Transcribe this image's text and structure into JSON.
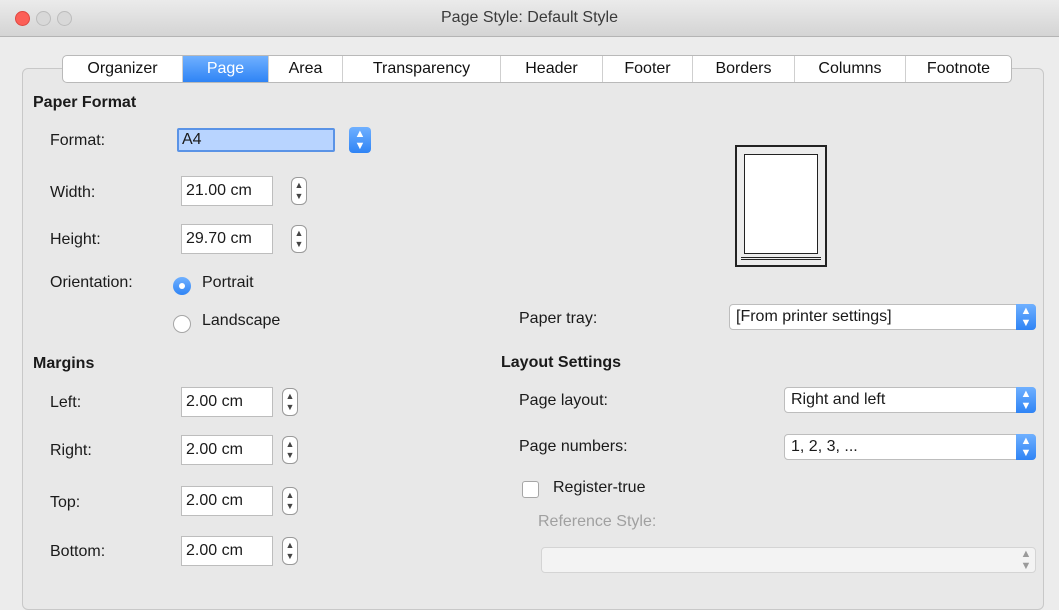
{
  "window": {
    "title": "Page Style: Default Style"
  },
  "tabs": [
    "Organizer",
    "Page",
    "Area",
    "Transparency",
    "Header",
    "Footer",
    "Borders",
    "Columns",
    "Footnote"
  ],
  "paper_format": {
    "heading": "Paper Format",
    "format_label": "Format:",
    "format_value": "A4",
    "width_label": "Width:",
    "width_value": "21.00 cm",
    "height_label": "Height:",
    "height_value": "29.70 cm",
    "orientation_label": "Orientation:",
    "portrait_label": "Portrait",
    "landscape_label": "Landscape",
    "paper_tray_label": "Paper tray:",
    "paper_tray_value": "[From printer settings]"
  },
  "margins": {
    "heading": "Margins",
    "left_label": "Left:",
    "left_value": "2.00 cm",
    "right_label": "Right:",
    "right_value": "2.00 cm",
    "top_label": "Top:",
    "top_value": "2.00 cm",
    "bottom_label": "Bottom:",
    "bottom_value": "2.00 cm"
  },
  "layout": {
    "heading": "Layout Settings",
    "page_layout_label": "Page layout:",
    "page_layout_value": "Right and left",
    "page_numbers_label": "Page numbers:",
    "page_numbers_value": "1, 2, 3, ...",
    "register_true_label": "Register-true",
    "reference_style_label": "Reference Style:"
  },
  "colors": {
    "accent": "#2f84f5",
    "close": "#fc5f57"
  }
}
